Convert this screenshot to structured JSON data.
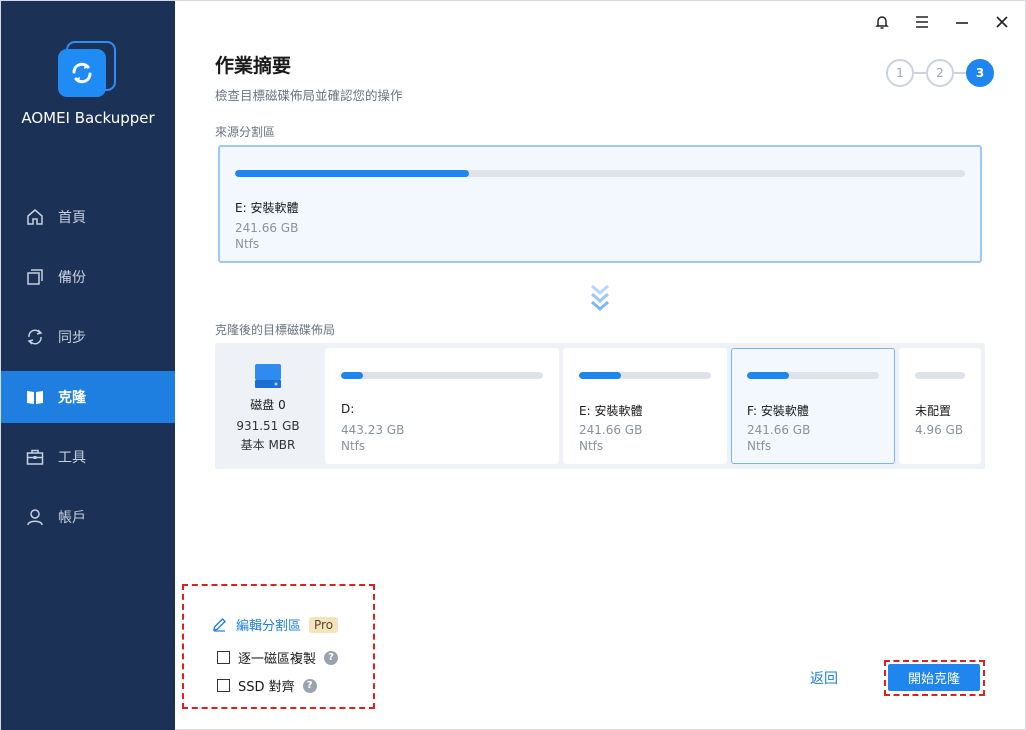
{
  "app": {
    "name": "AOMEI Backupper"
  },
  "sidebar": {
    "items": [
      {
        "label": "首頁",
        "icon": "home-icon",
        "active": false
      },
      {
        "label": "備份",
        "icon": "backup-icon",
        "active": false
      },
      {
        "label": "同步",
        "icon": "sync-icon",
        "active": false
      },
      {
        "label": "克隆",
        "icon": "clone-icon",
        "active": true
      },
      {
        "label": "工具",
        "icon": "toolbox-icon",
        "active": false
      },
      {
        "label": "帳戶",
        "icon": "user-icon",
        "active": false
      }
    ]
  },
  "titlebar": {
    "icons": [
      "bell-icon",
      "menu-icon",
      "minimize-icon",
      "close-icon"
    ]
  },
  "header": {
    "title": "作業摘要",
    "subtitle": "檢查目標磁碟佈局並確認您的操作",
    "steps": [
      "1",
      "2",
      "3"
    ],
    "active_step": 3
  },
  "source": {
    "label": "來源分割區",
    "name": "E: 安裝軟體",
    "size": "241.66 GB",
    "fs": "Ntfs",
    "usage": 0.32
  },
  "target": {
    "label": "克隆後的目標磁碟佈局",
    "disk": {
      "name": "磁盘 0",
      "size": "931.51 GB",
      "type": "基本 MBR"
    },
    "partitions": [
      {
        "name": "D:",
        "size": "443.23 GB",
        "fs": "Ntfs",
        "usage": 0.11
      },
      {
        "name": "E: 安裝軟體",
        "size": "241.66 GB",
        "fs": "Ntfs",
        "usage": 0.32
      },
      {
        "name": "F: 安裝軟體",
        "size": "241.66 GB",
        "fs": "Ntfs",
        "usage": 0.32,
        "selected": true
      },
      {
        "name": "未配置",
        "size": "4.96 GB",
        "fs": "",
        "usage": 0
      }
    ]
  },
  "options": {
    "edit_label": "編輯分割區",
    "pro_badge": "Pro",
    "sector_by_sector": "逐一磁區複製",
    "ssd_align": "SSD 對齊",
    "help_glyph": "?"
  },
  "footer": {
    "back": "返回",
    "start": "開始克隆"
  },
  "colors": {
    "accent": "#1f86f0",
    "sidebar": "#1c3156",
    "highlight_dash": "#e02020"
  }
}
